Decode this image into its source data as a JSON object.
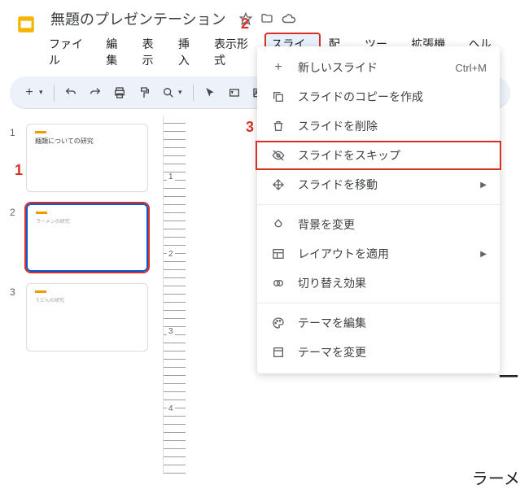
{
  "doc_title": "無題のプレゼンテーション",
  "menu": {
    "file": "ファイル",
    "edit": "編集",
    "view": "表示",
    "insert": "挿入",
    "format": "表示形式",
    "slide": "スライド",
    "arrange": "配置",
    "tools": "ツール",
    "extensions": "拡張機能",
    "help": "ヘルプ"
  },
  "slides": [
    {
      "num": "1",
      "title": "麺類についての研究"
    },
    {
      "num": "2",
      "title": "ラーメンの研究"
    },
    {
      "num": "3",
      "title": "うどんの研究"
    }
  ],
  "dropdown": {
    "new_slide": "新しいスライド",
    "new_slide_shortcut": "Ctrl+M",
    "duplicate": "スライドのコピーを作成",
    "delete": "スライドを削除",
    "skip": "スライドをスキップ",
    "move": "スライドを移動",
    "background": "背景を変更",
    "layout": "レイアウトを適用",
    "transition": "切り替え効果",
    "edit_theme": "テーマを編集",
    "change_theme": "テーマを変更"
  },
  "ruler_v": [
    "1",
    "2",
    "3",
    "4"
  ],
  "canvas_text": "ー",
  "canvas_hint": "ラーメ",
  "annotations": {
    "a1": "1",
    "a2": "2",
    "a3": "3"
  }
}
